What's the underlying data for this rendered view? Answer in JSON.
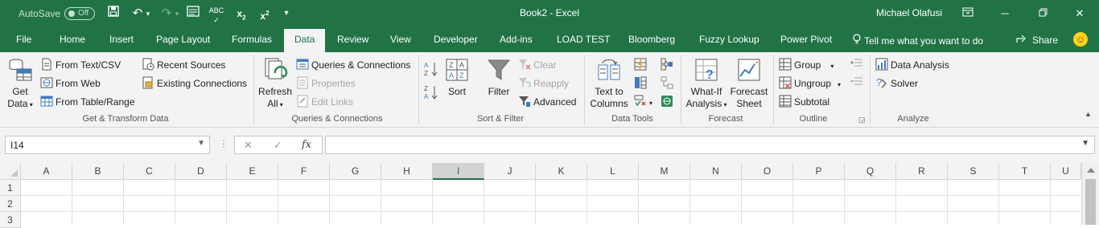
{
  "titlebar": {
    "autosave_label": "AutoSave",
    "autosave_state": "Off",
    "document_title": "Book2 - Excel",
    "user_name": "Michael Olafusi",
    "accent_color": "#217346"
  },
  "tabs": [
    {
      "label": "File"
    },
    {
      "label": "Home"
    },
    {
      "label": "Insert"
    },
    {
      "label": "Page Layout"
    },
    {
      "label": "Formulas"
    },
    {
      "label": "Data",
      "active": true
    },
    {
      "label": "Review"
    },
    {
      "label": "View"
    },
    {
      "label": "Developer"
    },
    {
      "label": "Add-ins"
    },
    {
      "label": "LOAD TEST"
    },
    {
      "label": "Bloomberg"
    },
    {
      "label": "Fuzzy Lookup"
    },
    {
      "label": "Power Pivot"
    }
  ],
  "tell_me": "Tell me what you want to do",
  "share_label": "Share",
  "ribbon": {
    "get_transform": {
      "group_label": "Get & Transform Data",
      "get_data_line1": "Get",
      "get_data_line2": "Data",
      "from_text_csv": "From Text/CSV",
      "from_web": "From Web",
      "from_table_range": "From Table/Range",
      "recent_sources": "Recent Sources",
      "existing_connections": "Existing Connections"
    },
    "queries": {
      "group_label": "Queries & Connections",
      "refresh_line1": "Refresh",
      "refresh_line2": "All",
      "queries_connections": "Queries & Connections",
      "properties": "Properties",
      "edit_links": "Edit Links"
    },
    "sort_filter": {
      "group_label": "Sort & Filter",
      "sort": "Sort",
      "filter": "Filter",
      "clear": "Clear",
      "reapply": "Reapply",
      "advanced": "Advanced"
    },
    "data_tools": {
      "group_label": "Data Tools",
      "text_to_columns_line1": "Text to",
      "text_to_columns_line2": "Columns"
    },
    "forecast": {
      "group_label": "Forecast",
      "what_if_line1": "What-If",
      "what_if_line2": "Analysis",
      "forecast_sheet_line1": "Forecast",
      "forecast_sheet_line2": "Sheet"
    },
    "outline": {
      "group_label": "Outline",
      "group": "Group",
      "ungroup": "Ungroup",
      "subtotal": "Subtotal"
    },
    "analyze": {
      "group_label": "Analyze",
      "data_analysis": "Data Analysis",
      "solver": "Solver"
    }
  },
  "formula_bar": {
    "name_box": "I14",
    "fx_label": "fx",
    "formula": ""
  },
  "grid": {
    "columns": [
      "A",
      "B",
      "C",
      "D",
      "E",
      "F",
      "G",
      "H",
      "I",
      "J",
      "K",
      "L",
      "M",
      "N",
      "O",
      "P",
      "Q",
      "R",
      "S",
      "T",
      "U"
    ],
    "selected_column": "I",
    "rows": [
      "1",
      "2",
      "3"
    ]
  }
}
